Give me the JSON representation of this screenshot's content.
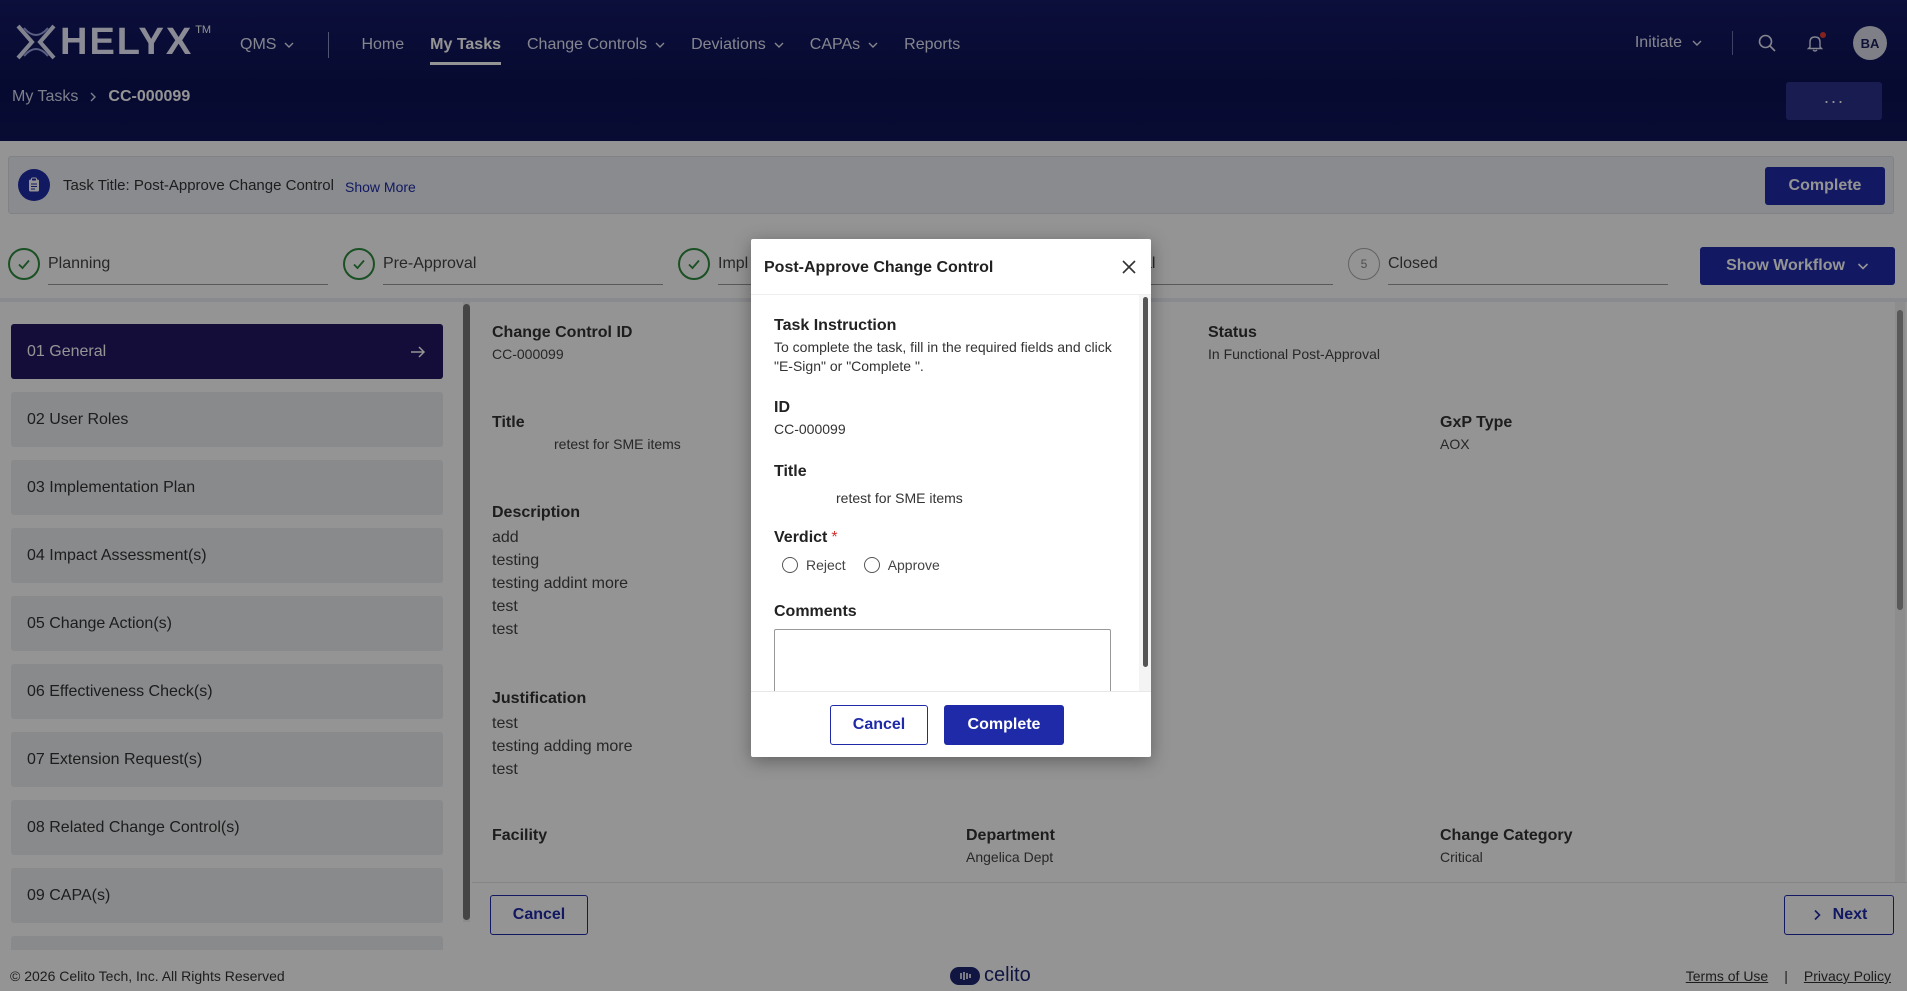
{
  "app": {
    "logo_text": "HELYX",
    "logo_tm": "TM",
    "nav": [
      {
        "label": "QMS",
        "has_chevron": true
      },
      {
        "label": "Home"
      },
      {
        "label": "My Tasks",
        "active": true
      },
      {
        "label": "Change Controls",
        "has_chevron": true
      },
      {
        "label": "Deviations",
        "has_chevron": true
      },
      {
        "label": "CAPAs",
        "has_chevron": true
      },
      {
        "label": "Reports"
      }
    ],
    "initiate_label": "Initiate",
    "avatar_initials": "BA",
    "more_label": "···"
  },
  "breadcrumb": {
    "parent": "My Tasks",
    "current": "CC-000099"
  },
  "task": {
    "title": "Task Title: Post-Approve Change Control",
    "show_more": "Show More",
    "complete_label": "Complete"
  },
  "workflow": {
    "steps": [
      {
        "label": "Planning",
        "status": "done"
      },
      {
        "label": "Pre-Approval",
        "status": "done"
      },
      {
        "label": "Impl",
        "status": "done"
      },
      {
        "label": "al",
        "status": "hidden"
      },
      {
        "label": "Closed",
        "status": "pending",
        "number": "5"
      }
    ],
    "show_workflow_label": "Show Workflow"
  },
  "sidebar": {
    "items": [
      {
        "label": "01 General",
        "active": true
      },
      {
        "label": "02 User Roles"
      },
      {
        "label": "03 Implementation Plan"
      },
      {
        "label": "04 Impact Assessment(s)"
      },
      {
        "label": "05 Change Action(s)"
      },
      {
        "label": "06 Effectiveness Check(s)"
      },
      {
        "label": "07 Extension Request(s)"
      },
      {
        "label": "08 Related Change Control(s)"
      },
      {
        "label": "09 CAPA(s)"
      }
    ]
  },
  "general": {
    "change_control_id": {
      "label": "Change Control ID",
      "value": "CC-000099"
    },
    "status": {
      "label": "Status",
      "value": "In Functional Post-Approval"
    },
    "title": {
      "label": "Title",
      "value": "retest for SME items"
    },
    "gxp_type": {
      "label": "GxP Type",
      "value": "AOX"
    },
    "description": {
      "label": "Description",
      "lines": [
        "add",
        "testing",
        "testing addint more",
        "test",
        "test"
      ]
    },
    "justification": {
      "label": "Justification",
      "lines": [
        "test",
        "testing adding more",
        "test"
      ]
    },
    "facility": {
      "label": "Facility",
      "value": ""
    },
    "department": {
      "label": "Department",
      "value": "Angelica Dept"
    },
    "change_category": {
      "label": "Change Category",
      "value": "Critical"
    }
  },
  "actions": {
    "cancel_label": "Cancel",
    "next_label": "Next"
  },
  "footer": {
    "copyright": "© 2026 Celito Tech, Inc. All Rights Reserved",
    "brand": "celito",
    "terms": "Terms of Use",
    "separator": "|",
    "privacy": "Privacy Policy"
  },
  "modal": {
    "title": "Post-Approve Change Control",
    "instruction_label": "Task Instruction",
    "instruction_text": "To complete the task, fill in the required fields and click \"E-Sign\" or \"Complete \".",
    "id_label": "ID",
    "id_value": "CC-000099",
    "title_label": "Title",
    "title_value": "retest for SME items",
    "verdict_label": "Verdict",
    "required_mark": "*",
    "verdict_options": [
      "Reject",
      "Approve"
    ],
    "comments_label": "Comments",
    "comments_value": "",
    "cancel_label": "Cancel",
    "complete_label": "Complete"
  },
  "colors": {
    "header_bg": "#0c1253",
    "primary": "#1f2aa8",
    "active_nav_item": "#231562",
    "success": "#2e8b3e"
  }
}
